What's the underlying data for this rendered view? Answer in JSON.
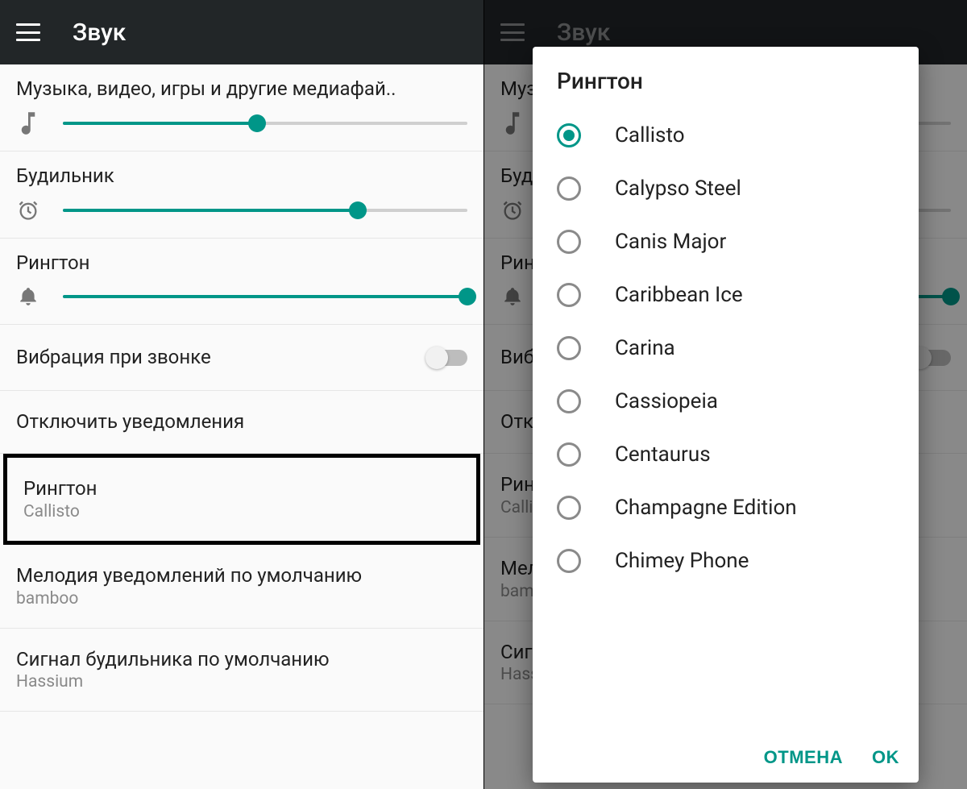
{
  "colors": {
    "accent": "#009688",
    "appbar_bg": "#222628"
  },
  "appbar": {
    "title": "Звук"
  },
  "sliders": {
    "media": {
      "label": "Музыка, видео, игры и другие медиафай..",
      "value_pct": 48,
      "icon": "music-note-icon"
    },
    "alarm": {
      "label": "Будильник",
      "value_pct": 73,
      "icon": "alarm-clock-icon"
    },
    "ringtone": {
      "label": "Рингтон",
      "value_pct": 100,
      "icon": "bell-icon"
    }
  },
  "toggles": {
    "vibrate_on_call": {
      "label": "Вибрация при звонке",
      "value": false
    }
  },
  "items": {
    "mute_notifications": {
      "label": "Отключить уведомления"
    },
    "ringtone": {
      "label": "Рингтон",
      "value": "Callisto"
    },
    "notification_sound": {
      "label": "Мелодия уведомлений по умолчанию",
      "value": "bamboo"
    },
    "alarm_sound": {
      "label": "Сигнал будильника по умолчанию",
      "value": "Hassium"
    }
  },
  "dialog": {
    "title": "Рингтон",
    "selected_index": 0,
    "options": [
      "Callisto",
      "Calypso Steel",
      "Canis Major",
      "Caribbean Ice",
      "Carina",
      "Cassiopeia",
      "Centaurus",
      "Champagne Edition",
      "Chimey Phone"
    ],
    "cancel_label": "ОТМЕНА",
    "ok_label": "OK"
  }
}
